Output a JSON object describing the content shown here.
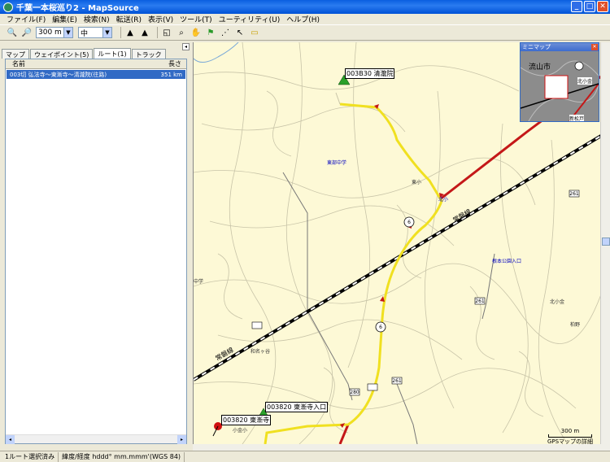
{
  "window": {
    "title": "千葉一本桜巡り2 - MapSource"
  },
  "menu": [
    "ファイル(F)",
    "編集(E)",
    "検索(N)",
    "転送(R)",
    "表示(V)",
    "ツール(T)",
    "ユーティリティ(U)",
    "ヘルプ(H)"
  ],
  "toolbar": {
    "zoom_value": "300 m",
    "detail_value": "中"
  },
  "tabs": [
    "マップ",
    "ウェイポイント(5)",
    "ルート(1)",
    "トラック"
  ],
  "route_list": {
    "headers": {
      "name": "名前",
      "length": "長さ"
    },
    "rows": [
      {
        "name": "003切 弘法寺〜東漸寺〜清瀧院(往路)",
        "length": "351 km"
      }
    ]
  },
  "map": {
    "waypoints": [
      {
        "label": "003B30 清瀧院"
      },
      {
        "label": "003820 東漸寺入口"
      },
      {
        "label": "003820 東漸寺"
      }
    ],
    "places": [
      "東部中学",
      "北小",
      "北小金",
      "根本公園入口",
      "小金小"
    ],
    "plain_labels": [
      "東小",
      "中学",
      "小金小",
      "新松戸",
      "北小金",
      "和名ヶ谷",
      "柏野"
    ],
    "rail_labels": [
      "常磐線",
      "常磐線"
    ],
    "route_shields": [
      "6",
      "6",
      "261",
      "261",
      "280",
      "261"
    ]
  },
  "minimap": {
    "title": "ミニマップ",
    "city": "流山市",
    "label": "北小金",
    "label2": "新松戸"
  },
  "scale": {
    "distance": "300 m",
    "caption": "GPSマップの詳細"
  },
  "status": {
    "selection": "1ルート選択済み",
    "coord_format": "緯度/経度 hddd° mm.mmm'(WGS 84)"
  },
  "colors": {
    "route": "#f0e020",
    "rail_red": "#c41818",
    "map_bg": "#fdf9d6"
  }
}
